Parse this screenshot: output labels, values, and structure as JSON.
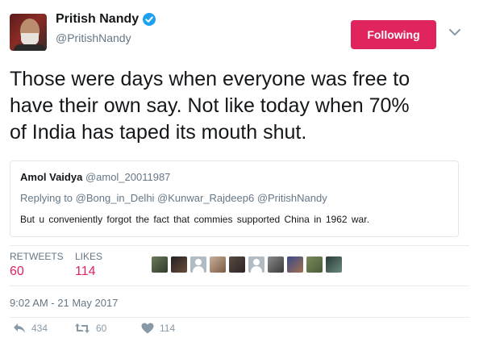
{
  "author": {
    "name": "Pritish Nandy",
    "handle": "@PritishNandy",
    "follow_label": "Following"
  },
  "tweet": {
    "line1": "Those were days when everyone was free to",
    "line2": "have their own say. Not like today when 70%",
    "line3": "of India has taped its mouth shut."
  },
  "quoted": {
    "name": "Amol Vaidya",
    "handle": "@amol_20011987",
    "reply_prefix": "Replying to",
    "reply_to": "@Bong_in_Delhi @Kunwar_Rajdeep6 @PritishNandy",
    "text": "But u conveniently forgot the fact that commies supported China in 1962 war."
  },
  "stats": {
    "retweets_label": "RETWEETS",
    "retweets": "60",
    "likes_label": "LIKES",
    "likes": "114"
  },
  "timestamp": "9:02 AM - 21 May 2017",
  "actions": {
    "reply_count": "434",
    "retweet_count": "60",
    "like_count": "114"
  },
  "colors": {
    "accent": "#e0245e",
    "verified": "#1da1f2",
    "muted": "#657786"
  },
  "icons": [
    "verified-badge-icon",
    "chevron-down-icon",
    "reply-icon",
    "retweet-icon",
    "heart-icon"
  ]
}
